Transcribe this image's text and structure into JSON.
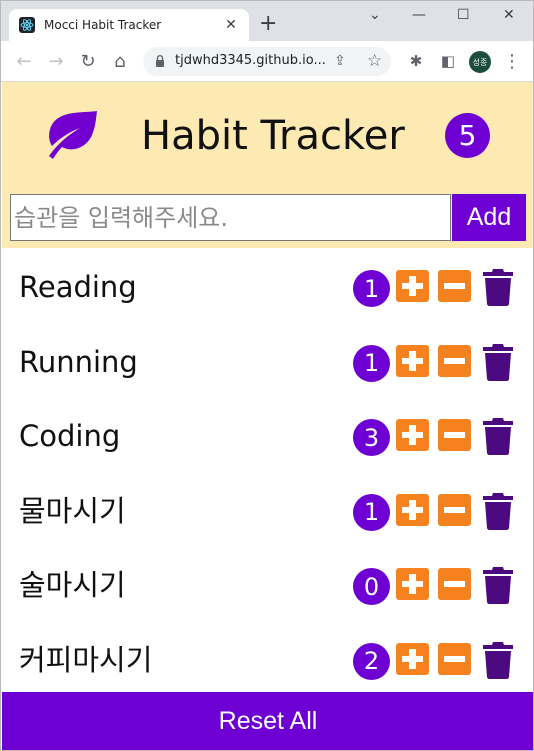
{
  "browser": {
    "tab_title": "Mocci Habit Tracker",
    "url": "tjdwhd3345.github.io...",
    "profile_initials": "성종"
  },
  "app": {
    "title": "Habit Tracker",
    "total_count": "5",
    "input_placeholder": "습관을 입력해주세요.",
    "add_label": "Add",
    "reset_label": "Reset All",
    "colors": {
      "accent": "#6e00d3",
      "header_bg": "#fde9b2",
      "button_orange": "#f5821f",
      "trash": "#4b0a7f"
    }
  },
  "habits": [
    {
      "name": "Reading",
      "count": "1"
    },
    {
      "name": "Running",
      "count": "1"
    },
    {
      "name": "Coding",
      "count": "3"
    },
    {
      "name": "물마시기",
      "count": "1"
    },
    {
      "name": "술마시기",
      "count": "0"
    },
    {
      "name": "커피마시기",
      "count": "2"
    }
  ]
}
